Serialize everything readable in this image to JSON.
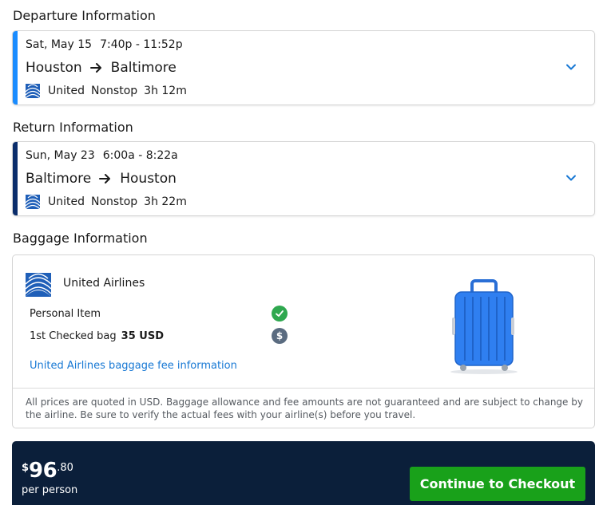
{
  "departure": {
    "section_title": "Departure Information",
    "date": "Sat, May 15",
    "time": "7:40p - 11:52p",
    "origin": "Houston",
    "destination": "Baltimore",
    "airline": "United",
    "stops": "Nonstop",
    "duration": "3h 12m"
  },
  "return": {
    "section_title": "Return Information",
    "date": "Sun, May 23",
    "time": "6:00a - 8:22a",
    "origin": "Baltimore",
    "destination": "Houston",
    "airline": "United",
    "stops": "Nonstop",
    "duration": "3h 22m"
  },
  "baggage": {
    "section_title": "Baggage Information",
    "airline": "United Airlines",
    "personal_item_label": "Personal Item",
    "checked_bag_label": "1st Checked bag",
    "checked_bag_fee": "35 USD",
    "fee_link": "United Airlines baggage fee information",
    "disclaimer": "All prices are quoted in USD. Baggage allowance and fee amounts are not guaranteed and are subject to change by the airline. Be sure to verify the actual fees with your airline(s) before you travel."
  },
  "checkout": {
    "currency_symbol": "$",
    "price_whole": "96",
    "price_cents": ".80",
    "per_person": "per person",
    "button_label": "Continue to Checkout"
  },
  "colors": {
    "depart_accent": "#1a8cff",
    "return_accent": "#0a2d6b",
    "checkout_bg": "#0b1f3a",
    "checkout_button": "#19a11a",
    "link": "#1778d4"
  }
}
